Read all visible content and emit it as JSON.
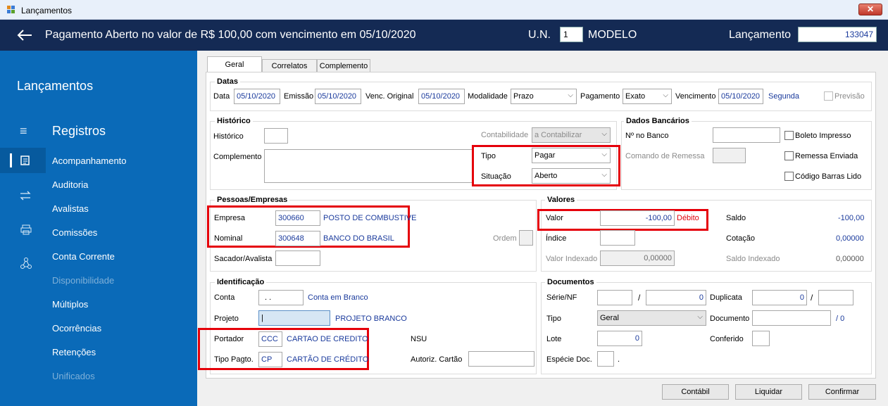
{
  "window": {
    "title": "Lançamentos",
    "close_label": "✕"
  },
  "header": {
    "title": "Pagamento Aberto no valor de R$ 100,00 com vencimento em 05/10/2020",
    "un_label": "U.N.",
    "un_value": "1",
    "un_name": "MODELO",
    "lancamento_label": "Lançamento",
    "lancamento_value": "133047"
  },
  "sidebar": {
    "title": "Lançamentos",
    "section": "Registros",
    "items": [
      {
        "label": "Acompanhamento"
      },
      {
        "label": "Auditoria"
      },
      {
        "label": "Avalistas"
      },
      {
        "label": "Comissões"
      },
      {
        "label": "Conta Corrente"
      },
      {
        "label": "Disponibilidade"
      },
      {
        "label": "Múltiplos"
      },
      {
        "label": "Ocorrências"
      },
      {
        "label": "Retenções"
      },
      {
        "label": "Unificados"
      }
    ]
  },
  "tabs": [
    "Geral",
    "Correlatos",
    "Complemento"
  ],
  "datas": {
    "title": "Datas",
    "data_label": "Data",
    "data": "05/10/2020",
    "emissao_label": "Emissão",
    "emissao": "05/10/2020",
    "venc_original_label": "Venc. Original",
    "venc_original": "05/10/2020",
    "modalidade_label": "Modalidade",
    "modalidade": "Prazo",
    "pagamento_label": "Pagamento",
    "pagamento": "Exato",
    "vencimento_label": "Vencimento",
    "vencimento": "05/10/2020",
    "dia_semana": "Segunda",
    "previsao_label": "Previsão"
  },
  "historico": {
    "title": "Histórico",
    "historico_label": "Histórico",
    "historico": "",
    "contabilidade_label": "Contabilidade",
    "contabilidade": "a Contabilizar",
    "complemento_label": "Complemento",
    "complemento": "",
    "tipo_label": "Tipo",
    "tipo": "Pagar",
    "situacao_label": "Situação",
    "situacao": "Aberto"
  },
  "bancarios": {
    "title": "Dados Bancários",
    "nro_banco_label": "Nº no Banco",
    "nro_banco": "",
    "comando_label": "Comando de Remessa",
    "comando": "",
    "boleto_label": "Boleto Impresso",
    "remessa_label": "Remessa Enviada",
    "codigo_label": "Código Barras Lido"
  },
  "pessoas": {
    "title": "Pessoas/Empresas",
    "empresa_label": "Empresa",
    "empresa_code": "300660",
    "empresa_name": "POSTO DE COMBUSTIVE",
    "nominal_label": "Nominal",
    "nominal_code": "300648",
    "nominal_name": "BANCO DO BRASIL",
    "ordem_label": "Ordem",
    "sacador_label": "Sacador/Avalista",
    "sacador": ""
  },
  "valores": {
    "title": "Valores",
    "valor_label": "Valor",
    "valor": "-100,00",
    "valor_tipo": "Débito",
    "saldo_label": "Saldo",
    "saldo": "-100,00",
    "indice_label": "Índice",
    "indice": "",
    "cotacao_label": "Cotação",
    "cotacao": "0,00000",
    "valor_indexado_label": "Valor Indexado",
    "valor_indexado": "0,00000",
    "saldo_indexado_label": "Saldo Indexado",
    "saldo_indexado": "0,00000"
  },
  "identificacao": {
    "title": "Identificação",
    "conta_label": "Conta",
    "conta": ". .",
    "conta_desc": "Conta em Branco",
    "projeto_label": "Projeto",
    "projeto": "|",
    "projeto_desc": "PROJETO BRANCO",
    "portador_label": "Portador",
    "portador": "CCC",
    "portador_desc": "CARTAO DE CREDITO",
    "nsu_label": "NSU",
    "tipo_pagto_label": "Tipo Pagto.",
    "tipo_pagto": "CP",
    "tipo_pagto_desc": "CARTÃO DE CRÉDITO",
    "autoriz_label": "Autoriz. Cartão",
    "autoriz": ""
  },
  "documentos": {
    "title": "Documentos",
    "serie_label": "Série/NF",
    "serie": "",
    "slash": "/",
    "nf": "0",
    "duplicata_label": "Duplicata",
    "duplicata": "0",
    "duplicata2": "",
    "tipo_label": "Tipo",
    "tipo": "Geral",
    "documento_label": "Documento",
    "documento": "",
    "doc_suffix": "/ 0",
    "lote_label": "Lote",
    "lote": "0",
    "conferido_label": "Conferido",
    "conferido": "",
    "especie_label": "Espécie Doc.",
    "especie": "",
    "especie_dot": "."
  },
  "buttons": {
    "contabil": "Contábil",
    "liquidar": "Liquidar",
    "confirmar": "Confirmar"
  },
  "colors": {
    "header_bg": "#142a54",
    "sidebar_bg": "#0a6ab8",
    "highlight": "#e5000a",
    "link": "#1a3a9c"
  }
}
